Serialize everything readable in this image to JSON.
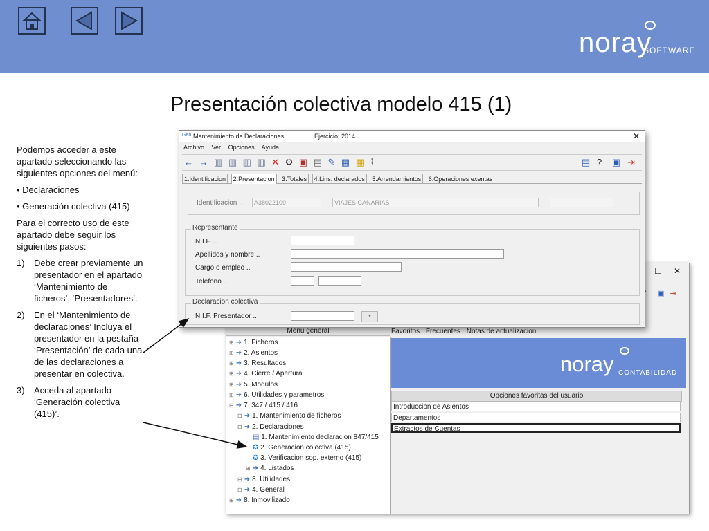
{
  "slide": {
    "title": "Presentación colectiva modelo 415 (1)",
    "brand": {
      "word": "noray",
      "sub": "SOFTWARE"
    },
    "nav": {
      "home_icon": "home-icon",
      "prev_icon": "left-triangle-icon",
      "next_icon": "right-triangle-icon"
    }
  },
  "instructions": {
    "intro": "Podemos acceder a este apartado seleccionando las siguientes opciones del menú:",
    "bullets": [
      "• Declaraciones",
      "• Generación colectiva (415)"
    ],
    "para": "Para el correcto uso de este apartado debe seguir los siguientes pasos:",
    "steps": [
      {
        "num": "1)",
        "text": "Debe crear previamente un presentador en el apartado ‘Mantenimiento de ficheros’, ‘Presentadores’."
      },
      {
        "num": "2)",
        "text": "En el ‘Mantenimiento de declaraciones’ Incluya el presentador en la pestaña ‘Presentación’ de cada una de las declaraciones a presentar en colectiva."
      },
      {
        "num": "3)",
        "text": "Acceda al apartado ‘Generación colectiva (415)’."
      }
    ]
  },
  "dialog": {
    "title": "Mantenimiento de Declaraciones",
    "ejercicio": "Ejercicio: 2014",
    "app_icon": "Gen",
    "menu": [
      "Archivo",
      "Ver",
      "Opciones",
      "Ayuda"
    ],
    "tabs": [
      "1.Identificacion",
      "2.Presentacion",
      "3.Totales",
      "4.Lins. declarados",
      "5.Arrendamientos",
      "6.Operaciones exentas"
    ],
    "identificacion_label": "Identificacion ..",
    "nif_value": "A38022109",
    "name_value": "VIAJES CANARIAS",
    "representante": {
      "title": "Representante",
      "labels": [
        "N.I.F. ..",
        "Apellidos y nombre ..",
        "Cargo o empleo ..",
        "Telefono .."
      ]
    },
    "declaracion": {
      "title": "Declaracion colectiva",
      "label": "N.I.F. Presentador .."
    }
  },
  "window2": {
    "menu_header": "Menu general",
    "tree": [
      "1. Ficheros",
      "2. Asientos",
      "3. Resultados",
      "4. Cierre / Apertura",
      "5. Modulos",
      "6. Utilidades y parametros",
      "7. 347 / 415 / 416",
      "1. Mantenimiento de ficheros",
      "2. Declaraciones",
      "1. Mantenimiento declaracion 847/415",
      "2. Generacion colectiva (415)",
      "3. Verificacion sop. externo (415)",
      "4. Listados",
      "8. Utilidades",
      "4. General",
      "8. Inmovilizado"
    ],
    "tabs": [
      "Favoritos",
      "Frecuentes",
      "Notas de actualizacion"
    ],
    "brand": {
      "word": "noray",
      "sub": "CONTABILIDAD"
    },
    "fav_header": "Opciones favoritas del usuario",
    "favorites": [
      "Introduccion de Asientos",
      "Departamentos",
      "Extractos de Cuentas"
    ]
  }
}
